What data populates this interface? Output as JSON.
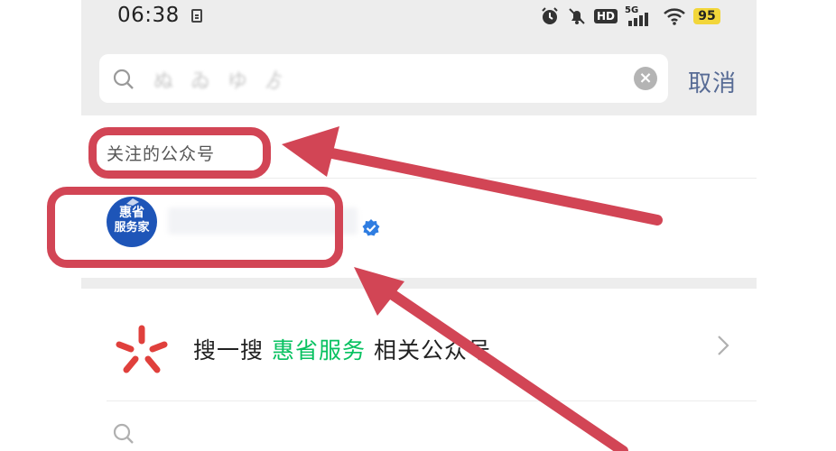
{
  "status_bar": {
    "time": "06:38",
    "network": "5G",
    "hd_badge": "HD",
    "battery": "95"
  },
  "search": {
    "query": "ぬ ゐ ゆ ゟ",
    "cancel_label": "取消"
  },
  "section": {
    "title": "关注的公众号"
  },
  "account": {
    "avatar_line1": "惠省",
    "avatar_line2": "服务家",
    "verified": true
  },
  "sou_yi_sou": {
    "prefix": "搜一搜",
    "keyword": "惠省服务",
    "suffix": "相关公众号"
  },
  "colors": {
    "accent_link": "#576b95",
    "keyword_green": "#07c160",
    "highlight_red": "#d24555",
    "avatar_blue": "#1e55b8",
    "verified_blue": "#2f7de1"
  }
}
